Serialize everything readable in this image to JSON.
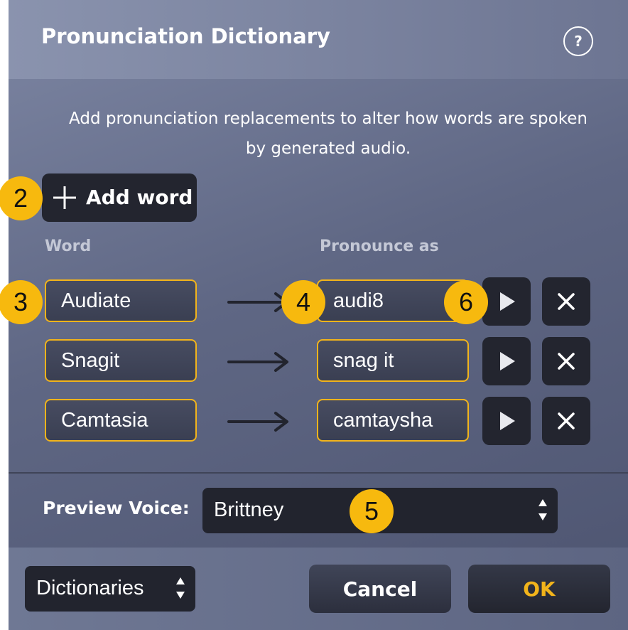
{
  "dialog": {
    "title": "Pronunciation Dictionary",
    "help_label": "?",
    "description": "Add pronunciation replacements to alter how words are spoken by generated audio."
  },
  "add_word": {
    "label": "Add word",
    "icon": "plus-icon"
  },
  "columns": {
    "word": "Word",
    "pronounce_as": "Pronounce as"
  },
  "entries": [
    {
      "word": "Audiate",
      "pronounce_as": "audi8"
    },
    {
      "word": "Snagit",
      "pronounce_as": "snag it"
    },
    {
      "word": "Camtasia",
      "pronounce_as": "camtaysha"
    }
  ],
  "preview_voice": {
    "label": "Preview Voice:",
    "value": "Brittney"
  },
  "footer": {
    "dictionaries": "Dictionaries",
    "cancel": "Cancel",
    "ok": "OK"
  },
  "callouts": [
    "2",
    "3",
    "4",
    "5",
    "6"
  ],
  "colors": {
    "accent": "#f2b41b",
    "callout": "#f7b90e",
    "button_dark": "#23252f",
    "dialog_bg": "#5f6784"
  }
}
